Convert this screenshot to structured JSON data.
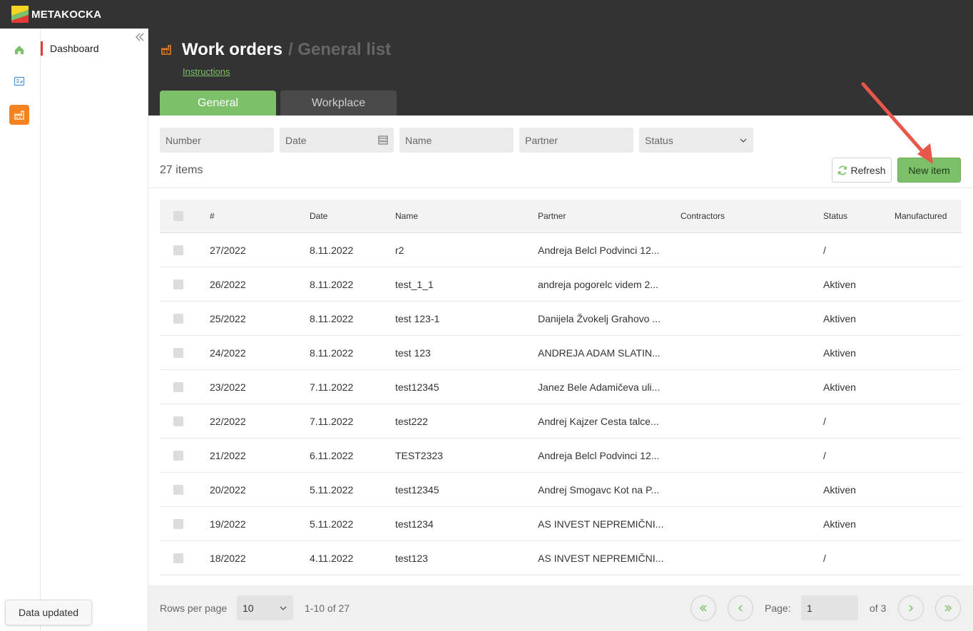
{
  "brand": {
    "name": "METAKOCKA"
  },
  "sidenav": {
    "items": [
      {
        "label": "Dashboard"
      }
    ]
  },
  "header": {
    "title": "Work orders",
    "subtitle": "/ General list",
    "instructions": "Instructions",
    "tabs": [
      {
        "label": "General",
        "active": true
      },
      {
        "label": "Workplace",
        "active": false
      }
    ]
  },
  "filters": {
    "number": "Number",
    "date": "Date",
    "name": "Name",
    "partner": "Partner",
    "status": "Status"
  },
  "toolbar": {
    "count_label": "27 items",
    "refresh_label": "Refresh",
    "new_item_label": "New item"
  },
  "table": {
    "columns": [
      "#",
      "Date",
      "Name",
      "Partner",
      "Contractors",
      "Status",
      "Manufactured"
    ],
    "rows": [
      {
        "num": "27/2022",
        "date": "8.11.2022",
        "name": "r2",
        "partner": "Andreja Belcl Podvinci 12...",
        "contractors": "",
        "status": "/",
        "manufactured": ""
      },
      {
        "num": "26/2022",
        "date": "8.11.2022",
        "name": "test_1_1",
        "partner": "andreja pogorelc videm 2...",
        "contractors": "",
        "status": "Aktiven",
        "manufactured": ""
      },
      {
        "num": "25/2022",
        "date": "8.11.2022",
        "name": "test 123-1",
        "partner": "Danijela Žvokelj Grahovo ...",
        "contractors": "",
        "status": "Aktiven",
        "manufactured": ""
      },
      {
        "num": "24/2022",
        "date": "8.11.2022",
        "name": "test 123",
        "partner": "ANDREJA ADAM SLATIN...",
        "contractors": "",
        "status": "Aktiven",
        "manufactured": ""
      },
      {
        "num": "23/2022",
        "date": "7.11.2022",
        "name": "test12345",
        "partner": "Janez Bele Adamičeva uli...",
        "contractors": "",
        "status": "Aktiven",
        "manufactured": ""
      },
      {
        "num": "22/2022",
        "date": "7.11.2022",
        "name": "test222",
        "partner": "Andrej Kajzer Cesta talce...",
        "contractors": "",
        "status": "/",
        "manufactured": ""
      },
      {
        "num": "21/2022",
        "date": "6.11.2022",
        "name": "TEST2323",
        "partner": "Andreja Belcl Podvinci 12...",
        "contractors": "",
        "status": "/",
        "manufactured": ""
      },
      {
        "num": "20/2022",
        "date": "5.11.2022",
        "name": "test12345",
        "partner": "Andrej Smogavc Kot na P...",
        "contractors": "",
        "status": "Aktiven",
        "manufactured": ""
      },
      {
        "num": "19/2022",
        "date": "5.11.2022",
        "name": "test1234",
        "partner": "AS INVEST NEPREMIČNI...",
        "contractors": "",
        "status": "Aktiven",
        "manufactured": ""
      },
      {
        "num": "18/2022",
        "date": "4.11.2022",
        "name": "test123",
        "partner": "AS INVEST NEPREMIČNI...",
        "contractors": "",
        "status": "/",
        "manufactured": ""
      }
    ]
  },
  "pagination": {
    "rows_per_page_label": "Rows per page",
    "rows_per_page": "10",
    "range": "1-10 of 27",
    "page_label": "Page:",
    "page": "1",
    "of_label": "of 3"
  },
  "toast": {
    "message": "Data updated"
  },
  "colors": {
    "accent_green": "#7cc06a",
    "header_dark": "#333333",
    "orange": "#f58220",
    "annotation_red": "#e8584a"
  }
}
